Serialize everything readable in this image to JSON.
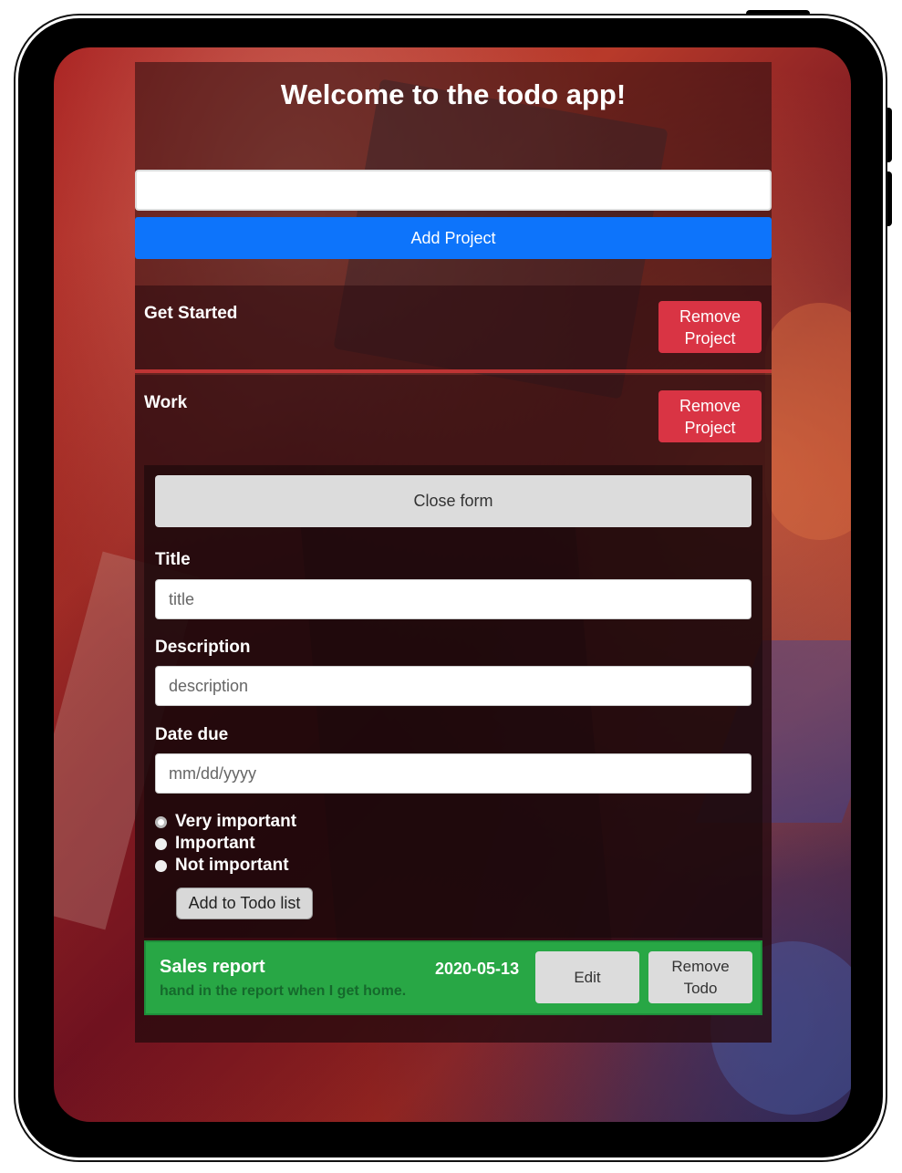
{
  "app": {
    "title": "Welcome to the todo app!"
  },
  "add_project": {
    "input_value": "",
    "button_label": "Add Project"
  },
  "projects": [
    {
      "name": "Get Started",
      "remove_label": "Remove Project"
    },
    {
      "name": "Work",
      "remove_label": "Remove Project"
    }
  ],
  "todo_form": {
    "close_label": "Close form",
    "title_label": "Title",
    "title_placeholder": "title",
    "description_label": "Description",
    "description_placeholder": "description",
    "date_label": "Date due",
    "date_placeholder": "mm/dd/yyyy",
    "priority_options": [
      {
        "label": "Very important",
        "checked": true
      },
      {
        "label": "Important",
        "checked": false
      },
      {
        "label": "Not important",
        "checked": false
      }
    ],
    "submit_label": "Add to Todo list"
  },
  "todos": [
    {
      "title": "Sales report",
      "description": "hand in the report when I get home.",
      "date_due": "2020-05-13",
      "edit_label": "Edit",
      "remove_label": "Remove Todo",
      "color": "#28a745"
    }
  ],
  "colors": {
    "primary": "#0d74fb",
    "danger": "#d93444",
    "success": "#28a745",
    "light": "#dcdcdc"
  }
}
